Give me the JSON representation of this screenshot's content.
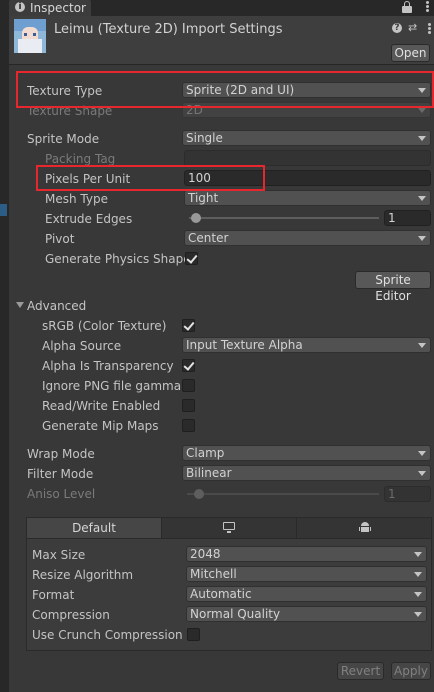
{
  "tab": {
    "title": "Inspector"
  },
  "header": {
    "title": "Leimu (Texture 2D) Import Settings",
    "open_label": "Open"
  },
  "general": {
    "texture_type_label": "Texture Type",
    "texture_type_value": "Sprite (2D and UI)",
    "texture_shape_label": "Texture Shape",
    "texture_shape_value": "2D",
    "sprite_mode_label": "Sprite Mode",
    "sprite_mode_value": "Single",
    "packing_tag_label": "Packing Tag",
    "packing_tag_value": "",
    "ppu_label": "Pixels Per Unit",
    "ppu_value": "100",
    "mesh_type_label": "Mesh Type",
    "mesh_type_value": "Tight",
    "extrude_label": "Extrude Edges",
    "extrude_value": "1",
    "pivot_label": "Pivot",
    "pivot_value": "Center",
    "gen_physics_label": "Generate Physics Shape",
    "gen_physics_checked": true,
    "sprite_editor_label": "Sprite Editor"
  },
  "advanced": {
    "header": "Advanced",
    "srgb_label": "sRGB (Color Texture)",
    "srgb_checked": true,
    "alpha_source_label": "Alpha Source",
    "alpha_source_value": "Input Texture Alpha",
    "alpha_transparency_label": "Alpha Is Transparency",
    "alpha_transparency_checked": true,
    "ignore_png_label": "Ignore PNG file gamma",
    "ignore_png_checked": false,
    "readwrite_label": "Read/Write Enabled",
    "readwrite_checked": false,
    "mipmaps_label": "Generate Mip Maps",
    "mipmaps_checked": false
  },
  "wrap": {
    "wrap_mode_label": "Wrap Mode",
    "wrap_mode_value": "Clamp",
    "filter_mode_label": "Filter Mode",
    "filter_mode_value": "Bilinear",
    "aniso_label": "Aniso Level",
    "aniso_value": "1"
  },
  "platform": {
    "tab_default": "Default",
    "max_size_label": "Max Size",
    "max_size_value": "2048",
    "resize_label": "Resize Algorithm",
    "resize_value": "Mitchell",
    "format_label": "Format",
    "format_value": "Automatic",
    "compression_label": "Compression",
    "compression_value": "Normal Quality",
    "crunch_label": "Use Crunch Compression",
    "crunch_checked": false
  },
  "footer": {
    "revert_label": "Revert",
    "apply_label": "Apply"
  }
}
